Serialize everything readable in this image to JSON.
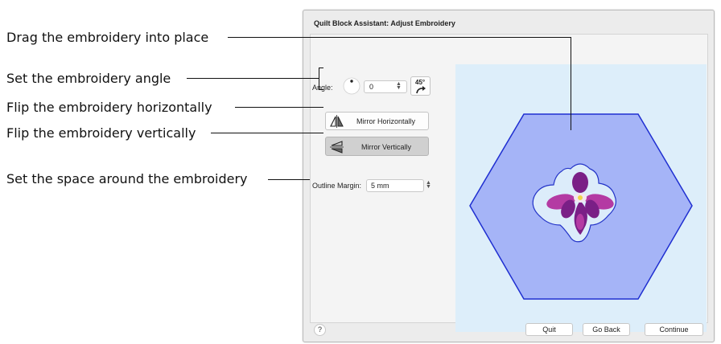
{
  "callouts": {
    "drag": "Drag the embroidery into place",
    "angle": "Set the embroidery angle",
    "flip_h": "Flip the embroidery horizontally",
    "flip_v": "Flip the embroidery vertically",
    "margin": "Set the space around the embroidery"
  },
  "dialog": {
    "title": "Quilt Block Assistant: Adjust Embroidery",
    "angle_label": "Angle:",
    "angle_value": "0",
    "rotate45_label": "45°",
    "mirror_h_label": "Mirror Horizontally",
    "mirror_v_label": "Mirror Vertically",
    "margin_label": "Outline Margin:",
    "margin_value": "5 mm",
    "help_label": "?",
    "quit_label": "Quit",
    "goback_label": "Go Back",
    "continue_label": "Continue"
  },
  "colors": {
    "canvas_bg": "#ddeefa",
    "hexagon_fill": "#a5b4f7",
    "hexagon_stroke": "#1f2fd1",
    "outline_fill": "#dcecfa",
    "petal_purple": "#7a1f86",
    "petal_magenta": "#b43aa3"
  },
  "icons": [
    "angle-dial-icon",
    "rotate-45-icon",
    "mirror-horizontal-icon",
    "mirror-vertical-icon",
    "spinner-icon"
  ]
}
